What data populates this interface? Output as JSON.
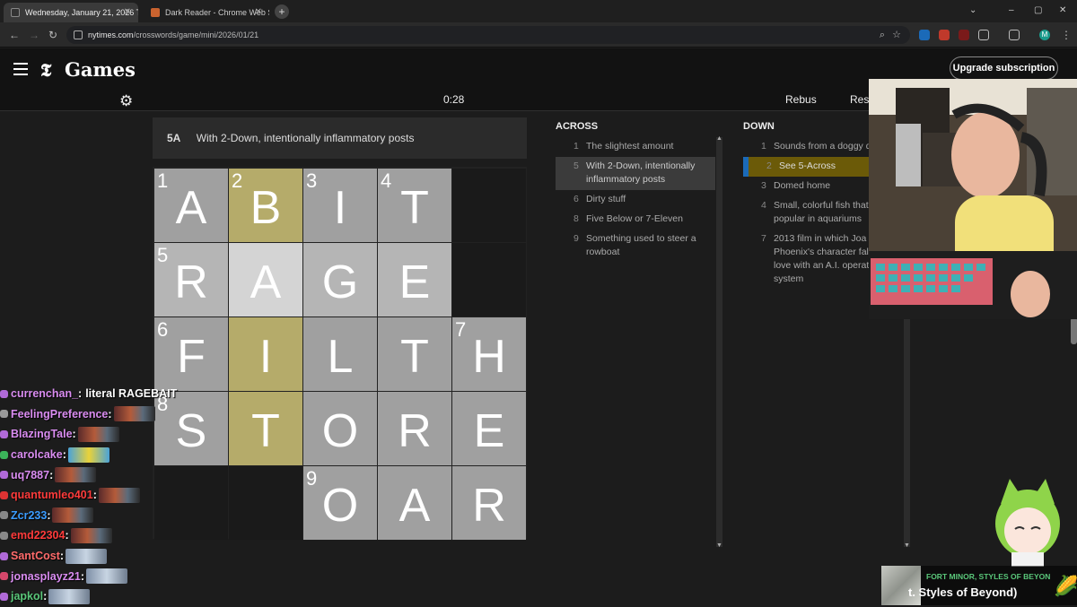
{
  "browser": {
    "tabs": [
      {
        "title": "Wednesday, January 21, 2026 T",
        "active": true
      },
      {
        "title": "Dark Reader - Chrome Web Sto",
        "active": false
      }
    ],
    "new_tab": "+",
    "url_host": "nytimes.com",
    "url_path": "/crosswords/game/mini/2026/01/21",
    "profile_initial": "M",
    "window_controls": {
      "minimize": "⌄",
      "min": "–",
      "max": "▢",
      "close": "✕"
    }
  },
  "nyt": {
    "logo_t": "𝕿",
    "logo_games": "Games",
    "upgrade_label": "Upgrade subscription",
    "timer": "0:28",
    "rebus_label": "Rebus",
    "reset_label": "Rese"
  },
  "clue_bar": {
    "number": "5A",
    "text": "With 2-Down, intentionally inflammatory posts"
  },
  "grid": {
    "rows": [
      [
        {
          "n": "1",
          "l": "A",
          "s": "norm"
        },
        {
          "n": "2",
          "l": "B",
          "s": "hl"
        },
        {
          "n": "3",
          "l": "I",
          "s": "norm"
        },
        {
          "n": "4",
          "l": "T",
          "s": "norm"
        },
        {
          "n": "",
          "l": "",
          "s": "blk"
        }
      ],
      [
        {
          "n": "5",
          "l": "R",
          "s": "word"
        },
        {
          "n": "",
          "l": "A",
          "s": "sel"
        },
        {
          "n": "",
          "l": "G",
          "s": "word"
        },
        {
          "n": "",
          "l": "E",
          "s": "word"
        },
        {
          "n": "",
          "l": "",
          "s": "blk"
        }
      ],
      [
        {
          "n": "6",
          "l": "F",
          "s": "norm"
        },
        {
          "n": "",
          "l": "I",
          "s": "hl"
        },
        {
          "n": "",
          "l": "L",
          "s": "norm"
        },
        {
          "n": "",
          "l": "T",
          "s": "norm"
        },
        {
          "n": "7",
          "l": "H",
          "s": "norm"
        }
      ],
      [
        {
          "n": "8",
          "l": "S",
          "s": "norm"
        },
        {
          "n": "",
          "l": "T",
          "s": "hl"
        },
        {
          "n": "",
          "l": "O",
          "s": "norm"
        },
        {
          "n": "",
          "l": "R",
          "s": "norm"
        },
        {
          "n": "",
          "l": "E",
          "s": "norm"
        }
      ],
      [
        {
          "n": "",
          "l": "",
          "s": "blk"
        },
        {
          "n": "",
          "l": "",
          "s": "blk"
        },
        {
          "n": "9",
          "l": "O",
          "s": "norm"
        },
        {
          "n": "",
          "l": "A",
          "s": "norm"
        },
        {
          "n": "",
          "l": "R",
          "s": "norm"
        }
      ]
    ]
  },
  "across": {
    "heading": "ACROSS",
    "clues": [
      {
        "num": "1",
        "text": "The slightest amount"
      },
      {
        "num": "5",
        "text": "With 2-Down, intentionally inflammatory posts"
      },
      {
        "num": "6",
        "text": "Dirty stuff"
      },
      {
        "num": "8",
        "text": "Five Below or 7-Eleven"
      },
      {
        "num": "9",
        "text": "Something used to steer a rowboat"
      }
    ]
  },
  "down": {
    "heading": "DOWN",
    "clues": [
      {
        "num": "1",
        "text": "Sounds from a doggy d"
      },
      {
        "num": "2",
        "text": "See 5-Across"
      },
      {
        "num": "3",
        "text": "Domed home"
      },
      {
        "num": "4",
        "text": "Small, colorful fish that popular in aquariums"
      },
      {
        "num": "7",
        "text": "2013 film in which Joa Phoenix's character fal love with an A.I. operat system"
      }
    ]
  },
  "chat": [
    {
      "user": "currenchan_",
      "color": "#d98cf0",
      "msg": "literal RAGEBAIT",
      "emote": ""
    },
    {
      "user": "FeelingPreference",
      "color": "#d98cf0",
      "msg": "",
      "emote": "flame"
    },
    {
      "user": "BlazingTale",
      "color": "#d98cf0",
      "msg": "",
      "emote": "flame"
    },
    {
      "user": "carolcake",
      "color": "#d98cf0",
      "msg": "",
      "emote": "yellow"
    },
    {
      "user": "uq7887",
      "color": "#d98cf0",
      "msg": "",
      "emote": "flame"
    },
    {
      "user": "quantumleo401",
      "color": "#ff3b3b",
      "msg": "",
      "emote": "flame"
    },
    {
      "user": "Zcr233",
      "color": "#3b9cff",
      "msg": "",
      "emote": "flame"
    },
    {
      "user": "emd22304",
      "color": "#ff3b3b",
      "msg": "",
      "emote": "flame"
    },
    {
      "user": "SantCost",
      "color": "#ff6b6b",
      "msg": "",
      "emote": "ice"
    },
    {
      "user": "jonasplayz21",
      "color": "#d98cf0",
      "msg": "",
      "emote": "ice"
    },
    {
      "user": "japkol",
      "color": "#5ac77a",
      "msg": "",
      "emote": "ice"
    }
  ],
  "now_playing": {
    "artist": "FORT MINOR, STYLES OF BEYON",
    "title": "t. Styles of Beyond)"
  },
  "colors": {
    "highlight_yellow": "#b5ab6a",
    "down_active": "#6b5a08",
    "blue_bar": "#1b6ab8"
  }
}
